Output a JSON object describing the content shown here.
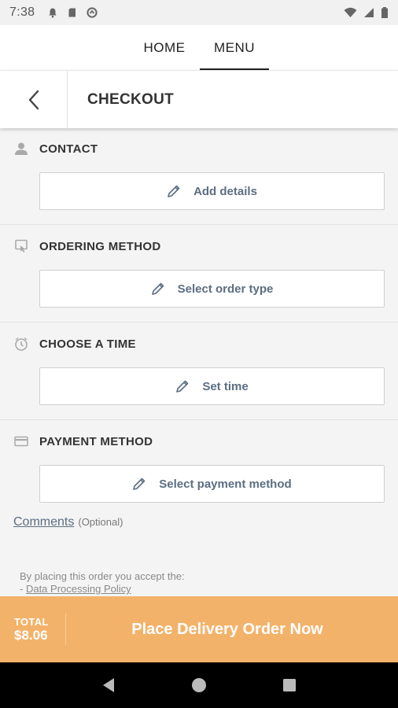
{
  "status_bar": {
    "time": "7:38"
  },
  "top_nav": {
    "tabs": [
      {
        "label": "HOME"
      },
      {
        "label": "MENU"
      }
    ],
    "active": "MENU"
  },
  "header": {
    "title": "CHECKOUT"
  },
  "sections": [
    {
      "label": "CONTACT",
      "button": "Add details",
      "icon": "person-icon"
    },
    {
      "label": "ORDERING METHOD",
      "button": "Select order type",
      "icon": "ordering-method-icon"
    },
    {
      "label": "CHOOSE A TIME",
      "button": "Set time",
      "icon": "clock-icon"
    },
    {
      "label": "PAYMENT METHOD",
      "button": "Select payment method",
      "icon": "card-icon"
    }
  ],
  "comments": {
    "label": "Comments",
    "optional": "(Optional)"
  },
  "policy": {
    "text": "By placing this order you accept the:",
    "bullet": "- ",
    "link": "Data Processing Policy"
  },
  "order_bar": {
    "total_label": "TOTAL",
    "total_value": "$8.06",
    "action": "Place Delivery Order Now",
    "color": "#f3b269"
  }
}
